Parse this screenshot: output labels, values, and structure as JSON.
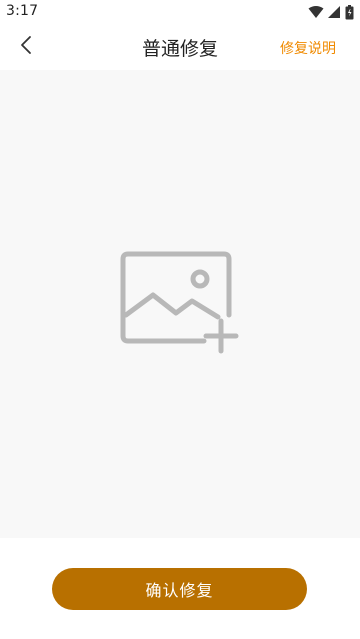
{
  "status_bar": {
    "time": "3:17",
    "icons": [
      "wifi-icon",
      "signal-icon",
      "battery-icon"
    ]
  },
  "header": {
    "back_icon": "chevron-left-icon",
    "title": "普通修复",
    "help_link": "修复说明"
  },
  "main": {
    "add_image_icon": "add-image-icon"
  },
  "footer": {
    "confirm_label": "确认修复"
  },
  "colors": {
    "accent_link": "#f08a00",
    "primary_button": "#b87000",
    "image_area_bg": "#f8f8f8",
    "placeholder_icon": "#b8b8b8"
  }
}
